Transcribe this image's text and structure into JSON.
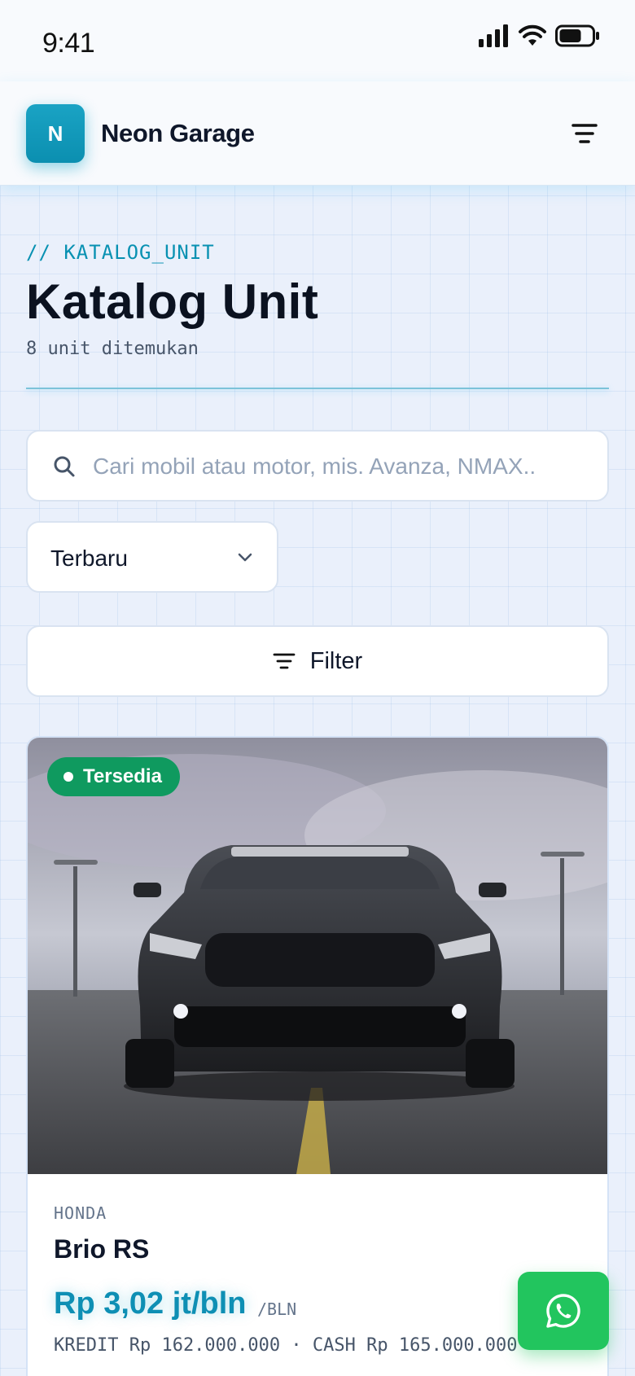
{
  "status_bar": {
    "time": "9:41",
    "icons": [
      "signal-icon",
      "wifi-icon",
      "battery-icon"
    ]
  },
  "header": {
    "logo_letter": "N",
    "brand": "Neon Garage",
    "menu_icon": "menu-icon"
  },
  "page": {
    "kicker": "// KATALOG_UNIT",
    "title": "Katalog Unit",
    "result_count": "8 unit ditemukan"
  },
  "search": {
    "placeholder": "Cari mobil atau motor, mis. Avanza, NMAX..",
    "value": ""
  },
  "sort": {
    "selected": "Terbaru"
  },
  "filter": {
    "label": "Filter"
  },
  "listing": {
    "status": "Tersedia",
    "brand": "HONDA",
    "model": "Brio RS",
    "price": "Rp 3,02 jt/bln",
    "price_unit": "/BLN",
    "price_detail": "KREDIT Rp 162.000.000 · CASH Rp 165.000.000"
  },
  "colors": {
    "accent": "#0891b2",
    "logo": "#0b8fb0",
    "available": "#0f9a5f",
    "whatsapp": "#22c55e",
    "price": "#0e8fb4"
  },
  "fab": {
    "icon": "whatsapp-icon"
  }
}
